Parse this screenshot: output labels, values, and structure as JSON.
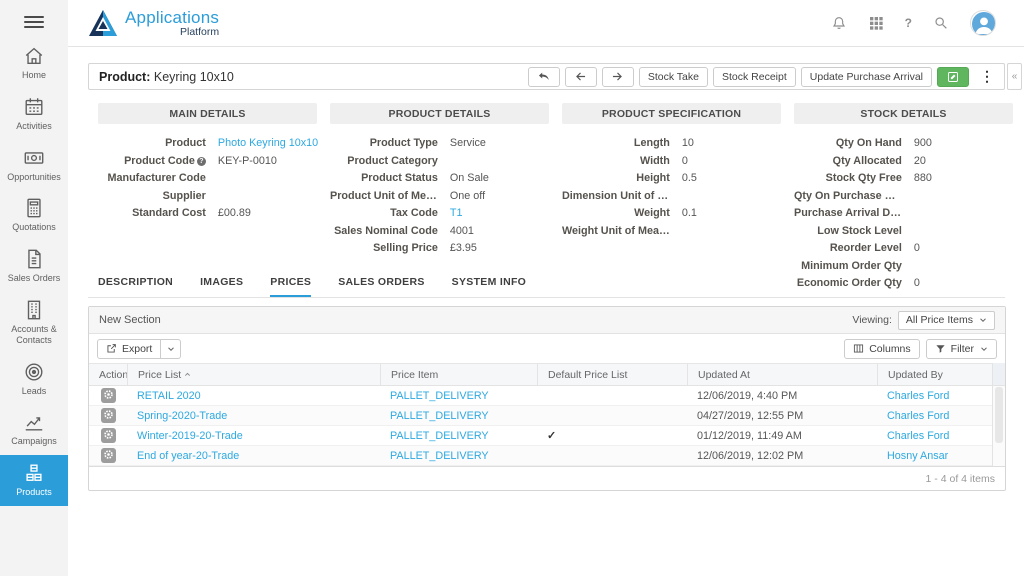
{
  "colors": {
    "accent": "#2b9dd9",
    "link": "#2da9e1",
    "green": "#5fb65f",
    "navy": "#27415e"
  },
  "topbar": {
    "brand_line1": "Applications",
    "brand_line2": "Platform",
    "help_label": "?",
    "icons": [
      "bell-icon",
      "apps-grid-icon",
      "help-icon",
      "search-icon",
      "avatar"
    ]
  },
  "sidebar": {
    "active": "Products",
    "items": [
      {
        "label": "Home",
        "icon": "home-icon"
      },
      {
        "label": "Activities",
        "icon": "calendar-icon"
      },
      {
        "label": "Opportunities",
        "icon": "banknote-icon"
      },
      {
        "label": "Quotations",
        "icon": "calculator-icon"
      },
      {
        "label": "Sales Orders",
        "icon": "document-icon"
      },
      {
        "label": "Accounts & Contacts",
        "icon": "building-icon"
      },
      {
        "label": "Leads",
        "icon": "target-icon"
      },
      {
        "label": "Campaigns",
        "icon": "chart-icon"
      },
      {
        "label": "Products",
        "icon": "cubes-icon"
      }
    ]
  },
  "record_header": {
    "label": "Product:",
    "value": "Keyring 10x10",
    "buttons": [
      "Stock Take",
      "Stock Receipt",
      "Update Purchase Arrival"
    ],
    "collapse_glyph": "«"
  },
  "sections": [
    {
      "title": "MAIN DETAILS",
      "fields": [
        {
          "label": "Product",
          "value": "Photo Keyring 10x10",
          "link": true
        },
        {
          "label": "Product Code",
          "info": true,
          "value": "KEY-P-0010"
        },
        {
          "label": "Manufacturer Code",
          "value": ""
        },
        {
          "label": "Supplier",
          "value": ""
        },
        {
          "label": "Standard Cost",
          "value": "£00.89"
        }
      ]
    },
    {
      "title": "PRODUCT DETAILS",
      "fields": [
        {
          "label": "Product Type",
          "value": "Service"
        },
        {
          "label": "Product Category",
          "value": ""
        },
        {
          "label": "Product Status",
          "value": "On Sale"
        },
        {
          "label": "Product Unit of Measure",
          "value": "One off"
        },
        {
          "label": "Tax Code",
          "value": "T1",
          "link": true
        },
        {
          "label": "Sales Nominal Code",
          "value": "4001"
        },
        {
          "label": "Selling Price",
          "value": "£3.95"
        }
      ]
    },
    {
      "title": "PRODUCT SPECIFICATION",
      "fields": [
        {
          "label": "Length",
          "value": "10"
        },
        {
          "label": "Width",
          "value": "0"
        },
        {
          "label": "Height",
          "value": "0.5"
        },
        {
          "label": "Dimension Unit of Meas...",
          "value": ""
        },
        {
          "label": "Weight",
          "value": "0.1"
        },
        {
          "label": "Weight Unit of Measure",
          "value": ""
        }
      ]
    },
    {
      "title": "STOCK DETAILS",
      "fields": [
        {
          "label": "Qty On Hand",
          "value": "900"
        },
        {
          "label": "Qty Allocated",
          "value": "20"
        },
        {
          "label": "Stock Qty Free",
          "value": "880"
        },
        {
          "label": "Qty On Purchase Order",
          "value": ""
        },
        {
          "label": "Purchase Arrival Date",
          "value": ""
        },
        {
          "label": "Low Stock Level",
          "value": ""
        },
        {
          "label": "Reorder Level",
          "value": "0"
        },
        {
          "label": "Minimum Order Qty",
          "value": ""
        },
        {
          "label": "Economic Order Qty",
          "value": "0"
        }
      ]
    }
  ],
  "tabs": {
    "active": "PRICES",
    "items": [
      "DESCRIPTION",
      "IMAGES",
      "PRICES",
      "SALES ORDERS",
      "SYSTEM INFO"
    ]
  },
  "panel": {
    "section_title": "New Section",
    "viewing_label": "Viewing:",
    "viewing_value": "All Price Items",
    "export_label": "Export",
    "columns_label": "Columns",
    "filter_label": "Filter",
    "table": {
      "headers": [
        "Actions",
        "Price List",
        "Price Item",
        "Default Price List",
        "Updated At",
        "Updated By"
      ],
      "sort_column": "Price List",
      "rows": [
        {
          "price_list": "RETAIL 2020",
          "price_item": "PALLET_DELIVERY",
          "default": false,
          "updated_at": "12/06/2019, 4:40 PM",
          "updated_by": "Charles Ford"
        },
        {
          "price_list": "Spring-2020-Trade",
          "price_item": "PALLET_DELIVERY",
          "default": false,
          "updated_at": "04/27/2019, 12:55 PM",
          "updated_by": "Charles Ford"
        },
        {
          "price_list": "Winter-2019-20-Trade",
          "price_item": "PALLET_DELIVERY",
          "default": true,
          "updated_at": "01/12/2019, 11:49 AM",
          "updated_by": "Charles Ford"
        },
        {
          "price_list": "End of year-20-Trade",
          "price_item": "PALLET_DELIVERY",
          "default": false,
          "updated_at": "12/06/2019, 12:02 PM",
          "updated_by": "Hosny Ansar"
        }
      ]
    },
    "footer": "1 - 4 of 4 items"
  }
}
